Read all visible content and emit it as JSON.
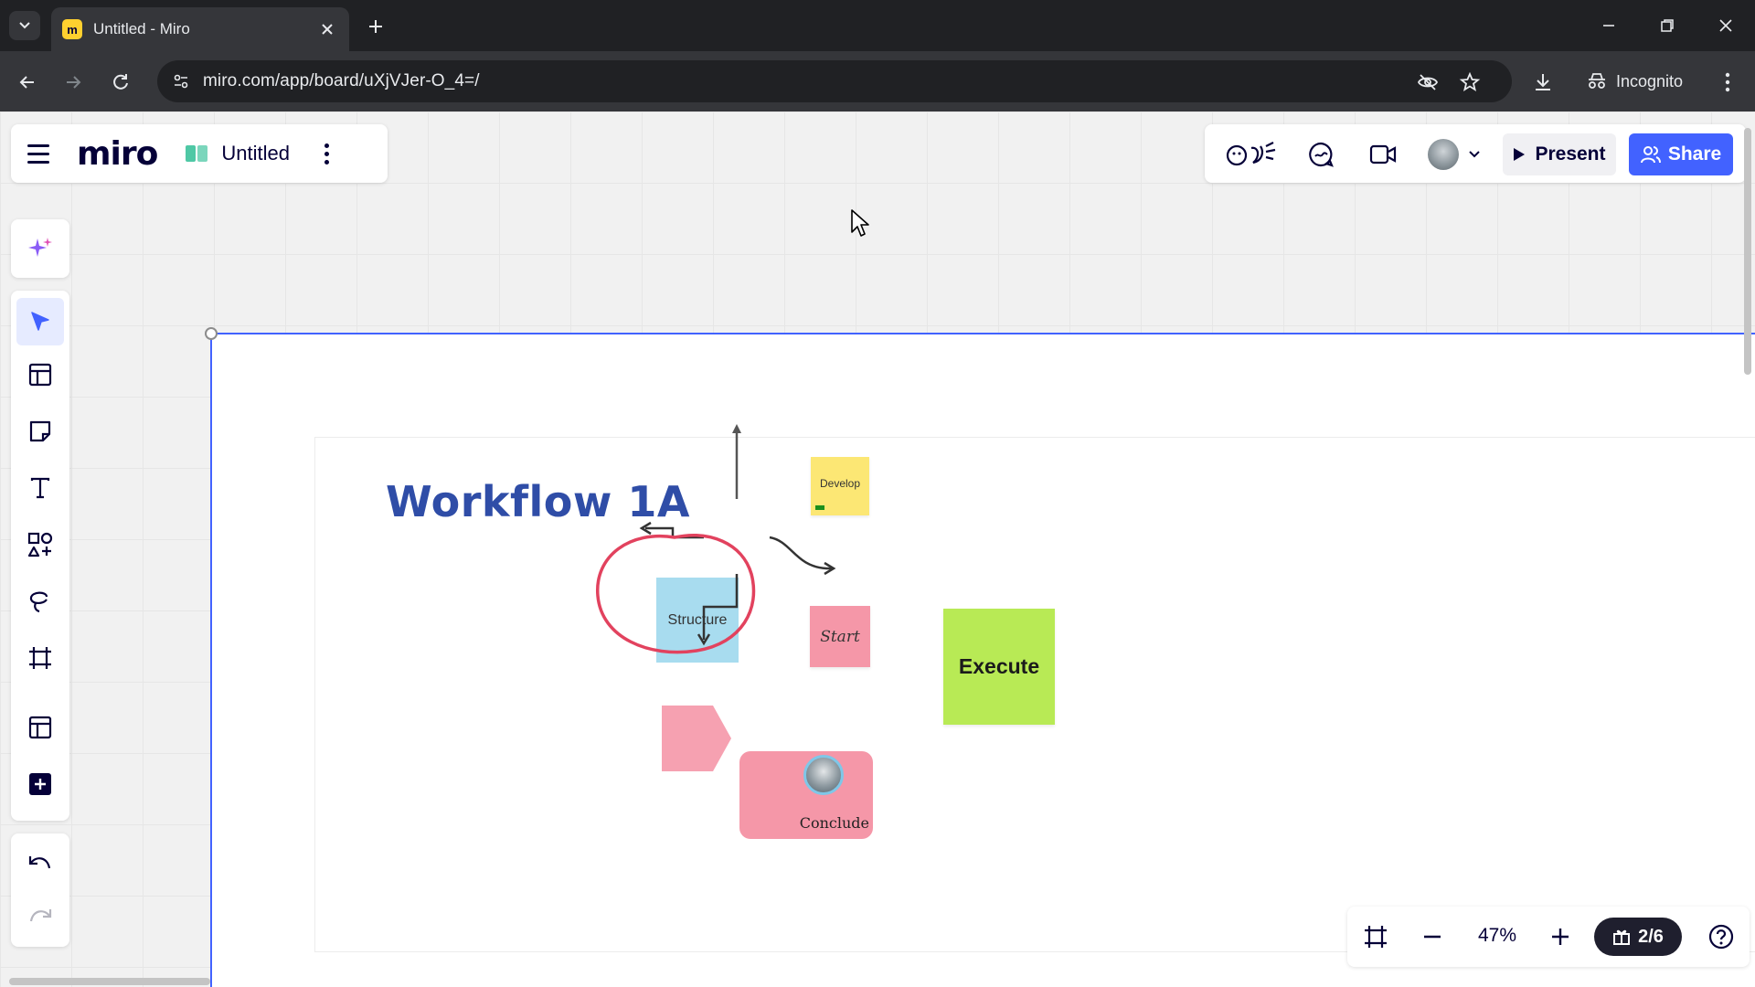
{
  "browser": {
    "tab_title": "Untitled - Miro",
    "url": "miro.com/app/board/uXjVJer-O_4=/",
    "incognito_label": "Incognito"
  },
  "board": {
    "logo": "miro",
    "title": "Untitled"
  },
  "top_actions": {
    "present_label": "Present",
    "share_label": "Share",
    "accent_color": "#4262ff"
  },
  "left_toolbar": {
    "tools": [
      "ai-assist",
      "select",
      "templates",
      "sticky-note",
      "text",
      "shapes",
      "lasso-pen",
      "frame",
      "table",
      "more-apps",
      "undo",
      "redo"
    ]
  },
  "canvas": {
    "title": "Workflow 1A",
    "stickies": {
      "develop": "Develop",
      "start": "Start",
      "execute": "Execute",
      "structure": "Structure",
      "conclude": "Conclude"
    }
  },
  "zoom": {
    "level": "47%",
    "pages": "2/6"
  }
}
